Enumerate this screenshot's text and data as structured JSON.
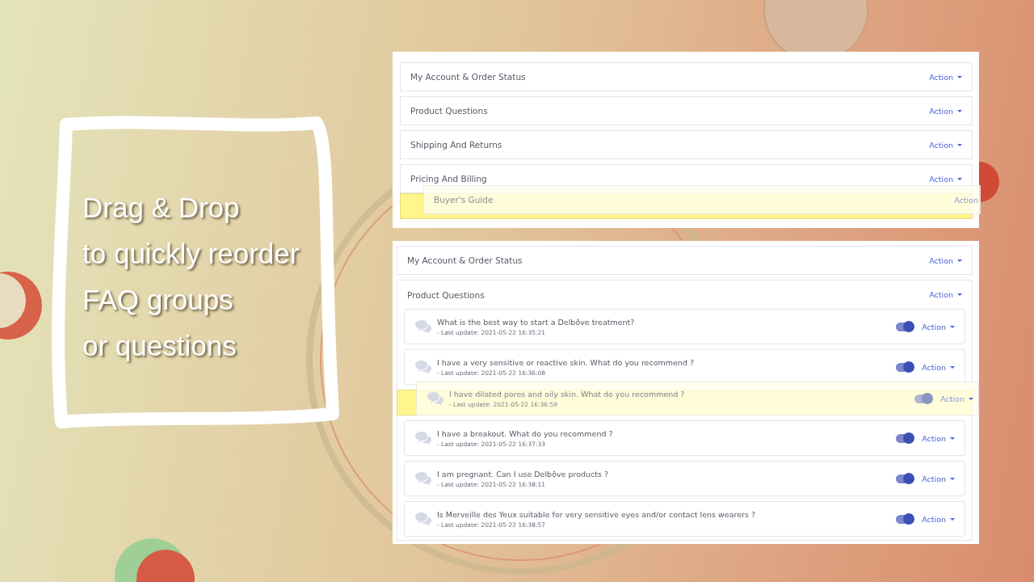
{
  "headline": [
    "Drag & Drop",
    "to quickly reorder",
    "FAQ groups",
    "or questions"
  ],
  "groups_panel": {
    "groups": [
      {
        "kind": "group",
        "title": "My Account & Order Status",
        "action": "Action"
      },
      {
        "kind": "group",
        "title": "Product Questions",
        "action": "Action"
      },
      {
        "kind": "group",
        "title": "Shipping And Returns",
        "action": "Action"
      },
      {
        "kind": "group",
        "title": "Pricing And Billing",
        "action": "Action"
      },
      {
        "kind": "drop-slot"
      }
    ],
    "dragged": {
      "title": "Buyer's Guide",
      "action": "Action"
    }
  },
  "faq_panel": {
    "groups": [
      {
        "title": "My Account & Order Status",
        "action": "Action",
        "expanded": false
      },
      {
        "title": "Product Questions",
        "action": "Action",
        "expanded": true,
        "questions": [
          {
            "kind": "question",
            "text": "What is the best way to start a Delbôve treatment?",
            "updated": "- Last update: 2021-05-22 16:35:21",
            "on": true,
            "action": "Action"
          },
          {
            "kind": "question",
            "text": "I have a very sensitive or reactive skin. What do you recommend ?",
            "updated": "- Last update: 2021-05-22 16:36:08",
            "on": true,
            "action": "Action"
          },
          {
            "kind": "drop-slot"
          },
          {
            "kind": "question",
            "text": "I have a breakout. What do you recommend ?",
            "updated": "- Last update: 2021-05-22 16:37:33",
            "on": true,
            "action": "Action"
          },
          {
            "kind": "question",
            "text": "I am pregnant. Can I use Delbôve products ?",
            "updated": "- Last update: 2021-05-22 16:38:11",
            "on": true,
            "action": "Action"
          },
          {
            "kind": "question",
            "text": "Is Merveille des Yeux suitable for very sensitive eyes and/or contact lens wearers ?",
            "updated": "- Last update: 2021-05-22 16:38:57",
            "on": true,
            "action": "Action"
          }
        ],
        "dragged": {
          "text": "I have dilated pores and oily skin. What do you recommend ?",
          "updated": "- Last update: 2021-05-22 16:36:59",
          "on": true,
          "action": "Action"
        }
      }
    ]
  }
}
